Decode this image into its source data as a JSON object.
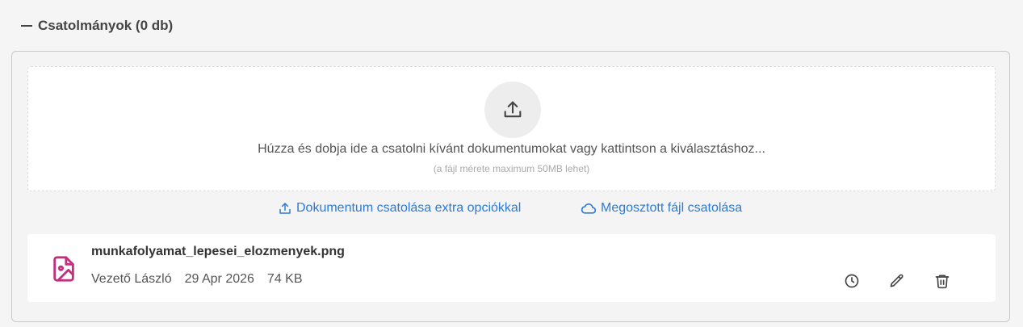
{
  "section": {
    "title": "Csatolmányok (0 db)"
  },
  "dropzone": {
    "icon": "upload-icon",
    "text": "Húzza és dobja ide a csatolni kívánt dokumentumokat vagy kattintson a kiválasztáshoz...",
    "hint": "(a fájl mérete maximum 50MB lehet)"
  },
  "links": {
    "extra_label": "Dokumentum csatolása extra opciókkal",
    "shared_label": "Megosztott fájl csatolása"
  },
  "file": {
    "name": "munkafolyamat_lepesei_elozmenyek.png",
    "owner": "Vezető László",
    "date": "29 Apr 2026",
    "size": "74 KB",
    "icon": "image-file-icon",
    "icon_color": "#c2307e"
  },
  "actions": [
    "history-icon",
    "edit-icon",
    "delete-icon"
  ],
  "colors": {
    "link": "#2b7bd8",
    "background": "#f5f5f5"
  }
}
